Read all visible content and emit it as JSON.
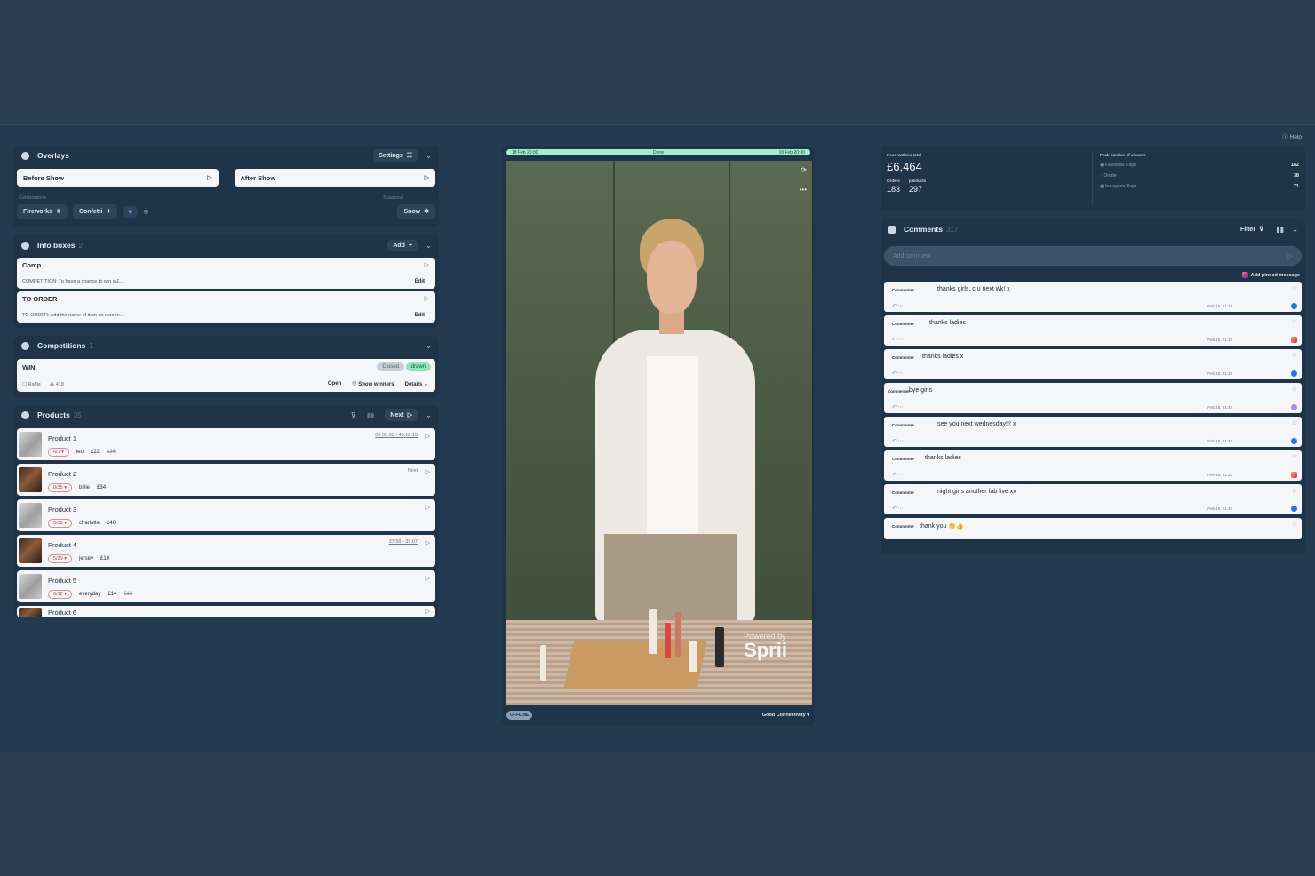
{
  "help": "Help",
  "overlays": {
    "title": "Overlays",
    "settings": "Settings",
    "before_show": "Before Show",
    "after_show": "After Show",
    "celebrations_label": "Celebrations",
    "seasonal_label": "Seasonal",
    "fireworks": "Fireworks",
    "confetti": "Confetti",
    "snow": "Snow"
  },
  "info_boxes": {
    "title": "Info boxes",
    "count": "2",
    "add": "Add",
    "items": [
      {
        "name": "Comp",
        "text": "COMPETITION: To have a chance to win a £...",
        "edit": "Edit"
      },
      {
        "name": "TO ORDER",
        "text": "TO ORDER: Add the name of item on screen...",
        "edit": "Edit"
      }
    ]
  },
  "competitions": {
    "title": "Competitions",
    "count": "1",
    "item": {
      "name": "WIN",
      "closed": "Closed",
      "drawn": "drawn",
      "type": "Raffle",
      "entries": "418",
      "open": "Open",
      "show_winners": "Show winners",
      "details": "Details"
    }
  },
  "products": {
    "title": "Products",
    "count": "35",
    "next": "Next",
    "items": [
      {
        "name": "Product 1",
        "stock": "6/1",
        "variant": "leo",
        "price": "£22",
        "old": "£36",
        "time": "00:00:03 - 40:18:15"
      },
      {
        "name": "Product 2",
        "stock": "0/35",
        "variant": "billie",
        "price": "£34",
        "old": "",
        "next_label": "Next"
      },
      {
        "name": "Product 3",
        "stock": "0/30",
        "variant": "charlotte",
        "price": "£40",
        "old": ""
      },
      {
        "name": "Product 4",
        "stock": "5/29",
        "variant": "jersey",
        "price": "£10",
        "old": "",
        "time": "37:58 - 39:07"
      },
      {
        "name": "Product 5",
        "stock": "0/12",
        "variant": "everyday",
        "price": "£14",
        "old": "£16"
      },
      {
        "name": "Product 6"
      }
    ]
  },
  "stream": {
    "start": "18 Feb 20:30",
    "status": "Done",
    "end": "18 Feb 20:30",
    "powered": "Powered by",
    "brand": "Sprii",
    "offline": "OFFLINE",
    "connectivity": "Good Connectivity"
  },
  "stats": {
    "reservations_label": "Reservations total",
    "reservations_value": "£6,464",
    "orders_label": "Orders",
    "orders_value": "183",
    "products_label": "products",
    "products_value": "297",
    "peak_label": "Peak number of viewers",
    "viewers": [
      {
        "source": "Facebook Page",
        "value": "182"
      },
      {
        "source": "Onsite",
        "value": "38"
      },
      {
        "source": "Instagram Page",
        "value": "71"
      }
    ]
  },
  "comments": {
    "title": "Comments",
    "count": "317",
    "filter": "Filter",
    "placeholder": "Add comment",
    "pinned": "Add pinned message",
    "items": [
      {
        "who": "Commenter",
        "text": "thanks girls, c u next wk! x",
        "time": "Feb 18, 21:33",
        "src": "fb"
      },
      {
        "who": "Commenter",
        "text": "thanks ladies",
        "time": "Feb 18, 21:33",
        "src": "ig"
      },
      {
        "who": "Commenter",
        "text": "thanks ladies x",
        "time": "Feb 18, 21:33",
        "src": "fb"
      },
      {
        "who": "Commenter",
        "text": "bye girls",
        "time": "Feb 18, 21:32",
        "src": "on"
      },
      {
        "who": "Commenter",
        "text": "see you next wednesday!!! x",
        "time": "Feb 18, 21:32",
        "src": "fb"
      },
      {
        "who": "Commenter",
        "text": "thanks ladies",
        "time": "Feb 18, 21:32",
        "src": "ig"
      },
      {
        "who": "Commenter",
        "text": "night girls another fab live xx",
        "time": "Feb 18, 21:32",
        "src": "fb"
      },
      {
        "who": "Commenter",
        "text": "thank you 👏👍",
        "time": "",
        "src": ""
      }
    ]
  },
  "colors": {
    "background": "#2a3d51",
    "panel": "#1f3448",
    "card": "#f4f6f9",
    "accent_green": "#9ff0c9",
    "facebook": "#1877f2"
  }
}
